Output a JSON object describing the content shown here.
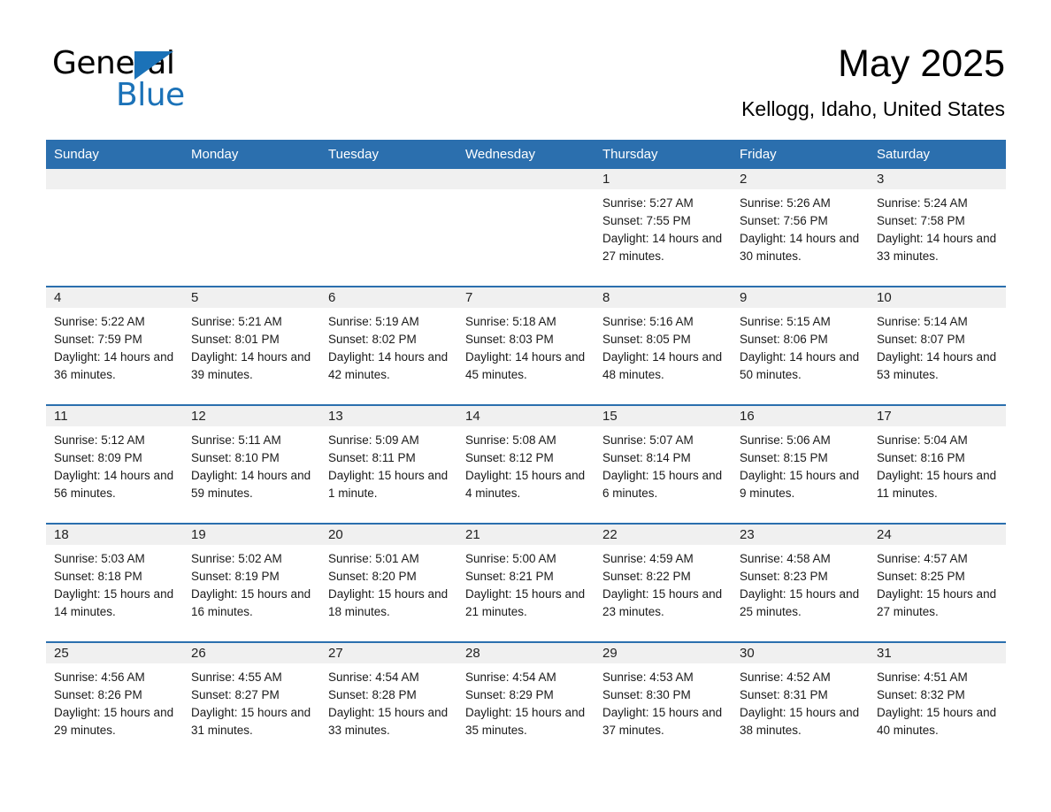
{
  "brand": {
    "name_part1": "General",
    "name_part2": "Blue"
  },
  "header": {
    "title": "May 2025",
    "subtitle": "Kellogg, Idaho, United States"
  },
  "colors": {
    "header_blue": "#2b6fae",
    "brand_blue": "#1b72b8",
    "daynum_band": "#f0f0f0",
    "row_rule": "#2b6fae"
  },
  "weekday_headers": [
    "Sunday",
    "Monday",
    "Tuesday",
    "Wednesday",
    "Thursday",
    "Friday",
    "Saturday"
  ],
  "weeks": [
    [
      {
        "day": "",
        "empty": true
      },
      {
        "day": "",
        "empty": true
      },
      {
        "day": "",
        "empty": true
      },
      {
        "day": "",
        "empty": true
      },
      {
        "day": "1",
        "sunrise": "Sunrise: 5:27 AM",
        "sunset": "Sunset: 7:55 PM",
        "daylight": "Daylight: 14 hours and 27 minutes."
      },
      {
        "day": "2",
        "sunrise": "Sunrise: 5:26 AM",
        "sunset": "Sunset: 7:56 PM",
        "daylight": "Daylight: 14 hours and 30 minutes."
      },
      {
        "day": "3",
        "sunrise": "Sunrise: 5:24 AM",
        "sunset": "Sunset: 7:58 PM",
        "daylight": "Daylight: 14 hours and 33 minutes."
      }
    ],
    [
      {
        "day": "4",
        "sunrise": "Sunrise: 5:22 AM",
        "sunset": "Sunset: 7:59 PM",
        "daylight": "Daylight: 14 hours and 36 minutes."
      },
      {
        "day": "5",
        "sunrise": "Sunrise: 5:21 AM",
        "sunset": "Sunset: 8:01 PM",
        "daylight": "Daylight: 14 hours and 39 minutes."
      },
      {
        "day": "6",
        "sunrise": "Sunrise: 5:19 AM",
        "sunset": "Sunset: 8:02 PM",
        "daylight": "Daylight: 14 hours and 42 minutes."
      },
      {
        "day": "7",
        "sunrise": "Sunrise: 5:18 AM",
        "sunset": "Sunset: 8:03 PM",
        "daylight": "Daylight: 14 hours and 45 minutes."
      },
      {
        "day": "8",
        "sunrise": "Sunrise: 5:16 AM",
        "sunset": "Sunset: 8:05 PM",
        "daylight": "Daylight: 14 hours and 48 minutes."
      },
      {
        "day": "9",
        "sunrise": "Sunrise: 5:15 AM",
        "sunset": "Sunset: 8:06 PM",
        "daylight": "Daylight: 14 hours and 50 minutes."
      },
      {
        "day": "10",
        "sunrise": "Sunrise: 5:14 AM",
        "sunset": "Sunset: 8:07 PM",
        "daylight": "Daylight: 14 hours and 53 minutes."
      }
    ],
    [
      {
        "day": "11",
        "sunrise": "Sunrise: 5:12 AM",
        "sunset": "Sunset: 8:09 PM",
        "daylight": "Daylight: 14 hours and 56 minutes."
      },
      {
        "day": "12",
        "sunrise": "Sunrise: 5:11 AM",
        "sunset": "Sunset: 8:10 PM",
        "daylight": "Daylight: 14 hours and 59 minutes."
      },
      {
        "day": "13",
        "sunrise": "Sunrise: 5:09 AM",
        "sunset": "Sunset: 8:11 PM",
        "daylight": "Daylight: 15 hours and 1 minute."
      },
      {
        "day": "14",
        "sunrise": "Sunrise: 5:08 AM",
        "sunset": "Sunset: 8:12 PM",
        "daylight": "Daylight: 15 hours and 4 minutes."
      },
      {
        "day": "15",
        "sunrise": "Sunrise: 5:07 AM",
        "sunset": "Sunset: 8:14 PM",
        "daylight": "Daylight: 15 hours and 6 minutes."
      },
      {
        "day": "16",
        "sunrise": "Sunrise: 5:06 AM",
        "sunset": "Sunset: 8:15 PM",
        "daylight": "Daylight: 15 hours and 9 minutes."
      },
      {
        "day": "17",
        "sunrise": "Sunrise: 5:04 AM",
        "sunset": "Sunset: 8:16 PM",
        "daylight": "Daylight: 15 hours and 11 minutes."
      }
    ],
    [
      {
        "day": "18",
        "sunrise": "Sunrise: 5:03 AM",
        "sunset": "Sunset: 8:18 PM",
        "daylight": "Daylight: 15 hours and 14 minutes."
      },
      {
        "day": "19",
        "sunrise": "Sunrise: 5:02 AM",
        "sunset": "Sunset: 8:19 PM",
        "daylight": "Daylight: 15 hours and 16 minutes."
      },
      {
        "day": "20",
        "sunrise": "Sunrise: 5:01 AM",
        "sunset": "Sunset: 8:20 PM",
        "daylight": "Daylight: 15 hours and 18 minutes."
      },
      {
        "day": "21",
        "sunrise": "Sunrise: 5:00 AM",
        "sunset": "Sunset: 8:21 PM",
        "daylight": "Daylight: 15 hours and 21 minutes."
      },
      {
        "day": "22",
        "sunrise": "Sunrise: 4:59 AM",
        "sunset": "Sunset: 8:22 PM",
        "daylight": "Daylight: 15 hours and 23 minutes."
      },
      {
        "day": "23",
        "sunrise": "Sunrise: 4:58 AM",
        "sunset": "Sunset: 8:23 PM",
        "daylight": "Daylight: 15 hours and 25 minutes."
      },
      {
        "day": "24",
        "sunrise": "Sunrise: 4:57 AM",
        "sunset": "Sunset: 8:25 PM",
        "daylight": "Daylight: 15 hours and 27 minutes."
      }
    ],
    [
      {
        "day": "25",
        "sunrise": "Sunrise: 4:56 AM",
        "sunset": "Sunset: 8:26 PM",
        "daylight": "Daylight: 15 hours and 29 minutes."
      },
      {
        "day": "26",
        "sunrise": "Sunrise: 4:55 AM",
        "sunset": "Sunset: 8:27 PM",
        "daylight": "Daylight: 15 hours and 31 minutes."
      },
      {
        "day": "27",
        "sunrise": "Sunrise: 4:54 AM",
        "sunset": "Sunset: 8:28 PM",
        "daylight": "Daylight: 15 hours and 33 minutes."
      },
      {
        "day": "28",
        "sunrise": "Sunrise: 4:54 AM",
        "sunset": "Sunset: 8:29 PM",
        "daylight": "Daylight: 15 hours and 35 minutes."
      },
      {
        "day": "29",
        "sunrise": "Sunrise: 4:53 AM",
        "sunset": "Sunset: 8:30 PM",
        "daylight": "Daylight: 15 hours and 37 minutes."
      },
      {
        "day": "30",
        "sunrise": "Sunrise: 4:52 AM",
        "sunset": "Sunset: 8:31 PM",
        "daylight": "Daylight: 15 hours and 38 minutes."
      },
      {
        "day": "31",
        "sunrise": "Sunrise: 4:51 AM",
        "sunset": "Sunset: 8:32 PM",
        "daylight": "Daylight: 15 hours and 40 minutes."
      }
    ]
  ]
}
